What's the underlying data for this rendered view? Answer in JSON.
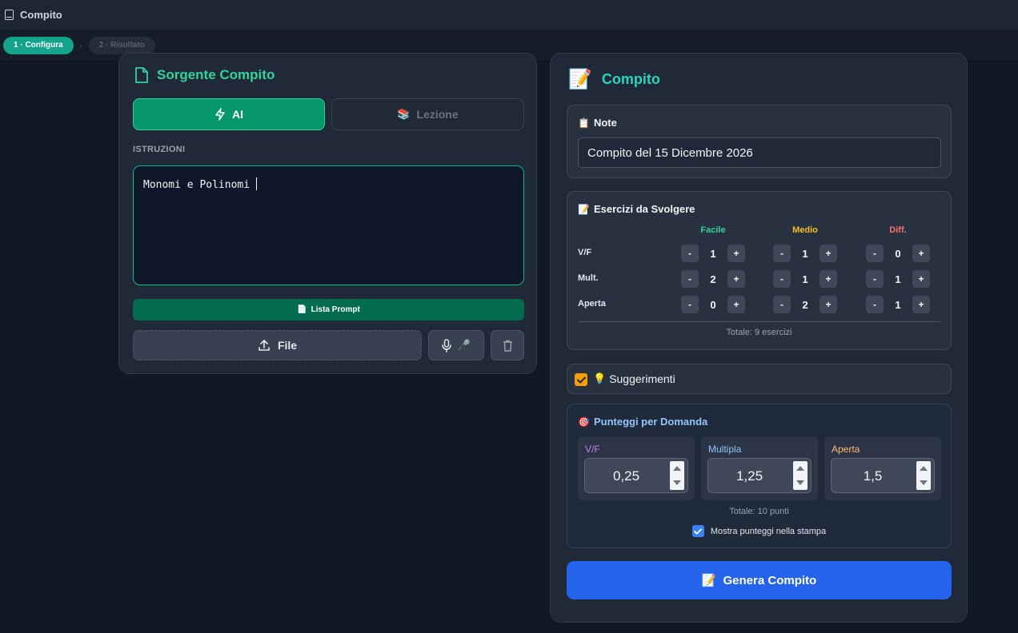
{
  "window": {
    "title": "Compito"
  },
  "steps": [
    {
      "label": "1 · Configura"
    },
    {
      "label": "2 · Risultato"
    }
  ],
  "source": {
    "title": "Sorgente Compito",
    "tabs": [
      {
        "label": "AI"
      },
      {
        "label": "Lezione"
      }
    ],
    "instructions_label": "ISTRUZIONI",
    "instructions_value": "Monomi e Polinomi",
    "prompt_list_label": "Lista Prompt",
    "file_label": "File"
  },
  "compito": {
    "title": "Compito",
    "note": {
      "title": "Note",
      "value": "Compito del 15 Dicembre 2026"
    },
    "exercises": {
      "title": "Esercizi da Svolgere",
      "difficulties": [
        {
          "label": "Facile",
          "color": "#34d399"
        },
        {
          "label": "Medio",
          "color": "#fbbf24"
        },
        {
          "label": "Diff.",
          "color": "#f87171"
        }
      ],
      "rows": [
        {
          "label": "V/F",
          "values": [
            "1",
            "1",
            "0"
          ]
        },
        {
          "label": "Mult.",
          "values": [
            "2",
            "1",
            "1"
          ]
        },
        {
          "label": "Aperta",
          "values": [
            "0",
            "2",
            "1"
          ]
        }
      ],
      "minus_label": "-",
      "plus_label": "+",
      "total": "Totale: 9 esercizi"
    },
    "suggestions": {
      "label": "Suggerimenti",
      "checked": true
    },
    "points": {
      "title": "Punteggi per Domanda",
      "items": [
        {
          "label": "V/F",
          "value": "0,25",
          "color": "#c084fc"
        },
        {
          "label": "Multipla",
          "value": "1,25",
          "color": "#93c5fd"
        },
        {
          "label": "Aperta",
          "value": "1,5",
          "color": "#fdba74"
        }
      ],
      "total": "Totale: 10 punti",
      "show_in_print": {
        "label": "Mostra punteggi nella stampa",
        "checked": true
      }
    },
    "generate_label": "Genera Compito"
  }
}
